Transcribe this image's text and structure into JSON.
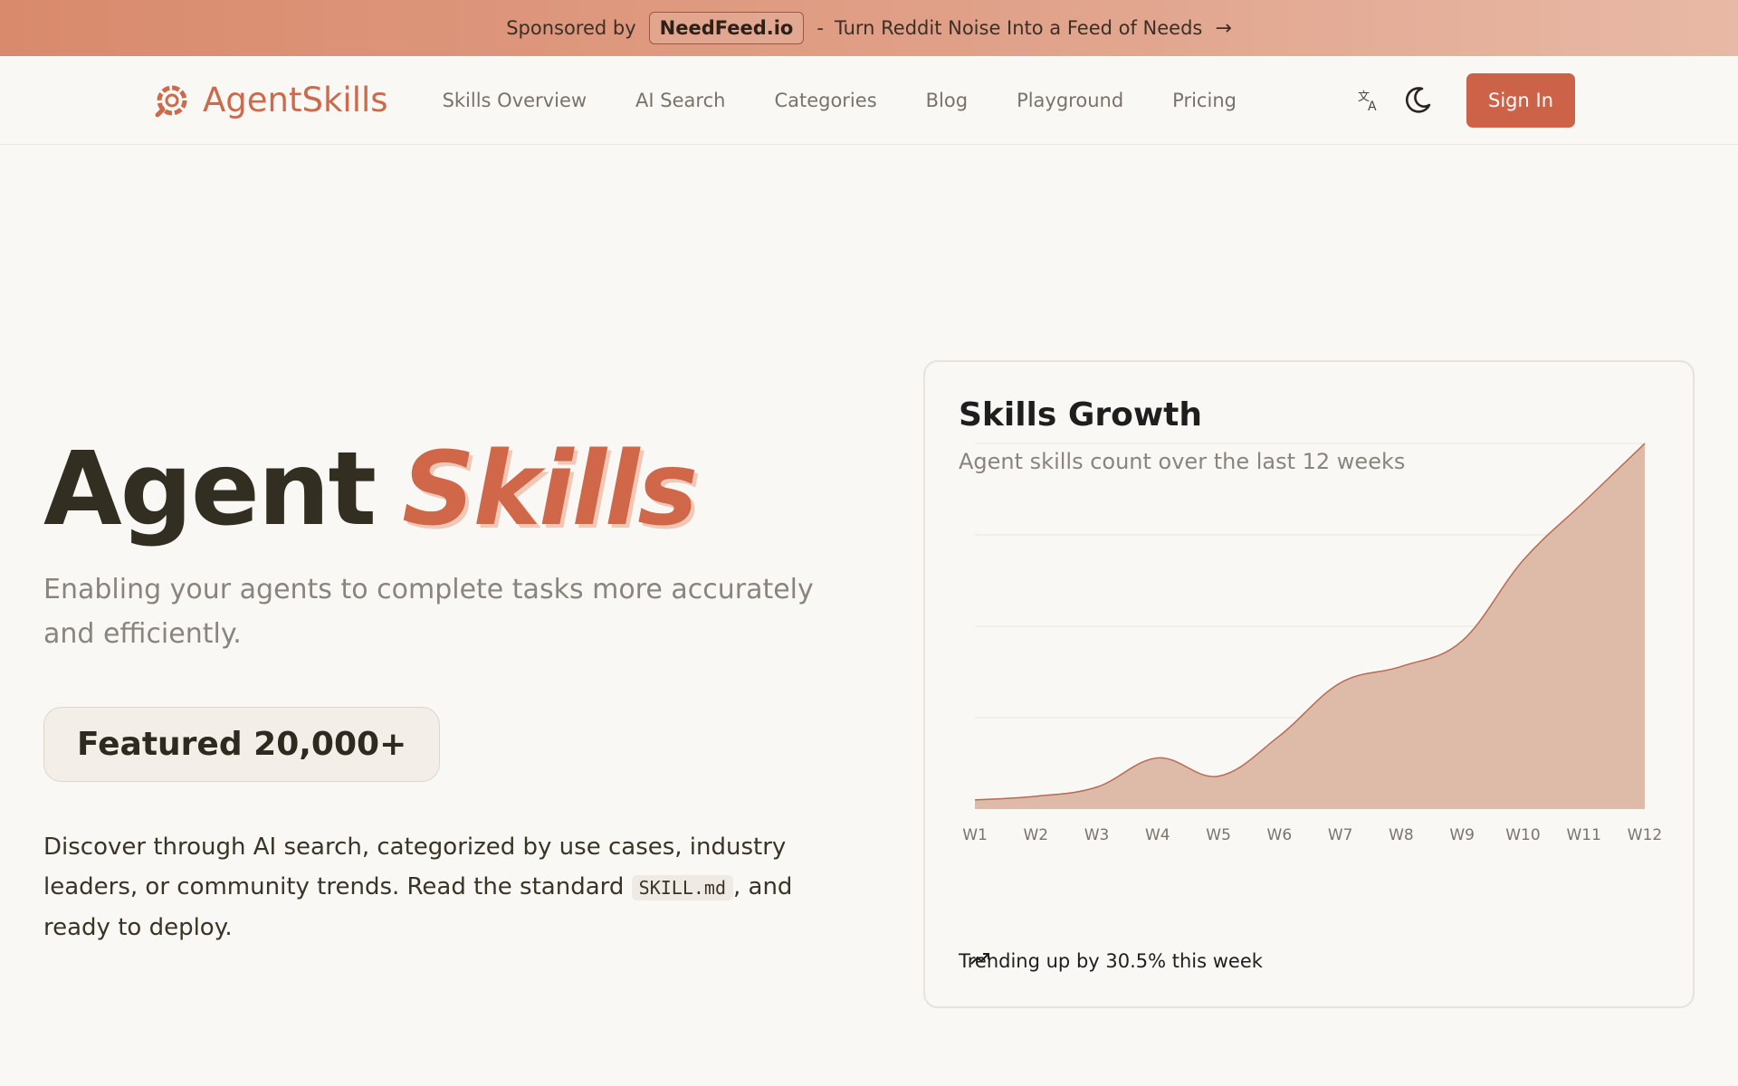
{
  "sponsor": {
    "prefix": "Sponsored by",
    "brand": "NeedFeed.io",
    "separator": "-",
    "tagline": "Turn Reddit Noise Into a Feed of Needs"
  },
  "nav": {
    "brand": "AgentSkills",
    "links": [
      "Skills Overview",
      "AI Search",
      "Categories",
      "Blog",
      "Playground",
      "Pricing"
    ],
    "signin": "Sign In"
  },
  "hero": {
    "title_word1": "Agent",
    "title_word2": "Skills",
    "subtitle": "Enabling your agents to complete tasks more accurately and efficiently.",
    "featured": "Featured 20,000+",
    "desc_before": "Discover through AI search, categorized by use cases, industry leaders, or community trends. Read the standard ",
    "desc_code": "SKILL.md",
    "desc_after": ", and ready to deploy."
  },
  "colors": {
    "accent": "#cc6247",
    "area_fill": "#dcb6a4",
    "area_stroke": "#b86a52"
  },
  "chart_data": {
    "type": "area",
    "title": "Skills Growth",
    "subtitle": "Agent skills count over the last 12 weeks",
    "categories": [
      "W1",
      "W2",
      "W3",
      "W4",
      "W5",
      "W6",
      "W7",
      "W8",
      "W9",
      "W10",
      "W11",
      "W12"
    ],
    "values": [
      2.5,
      3.5,
      6,
      14,
      9,
      20,
      34.5,
      39,
      46,
      68,
      84,
      100
    ],
    "ylim": [
      0,
      100
    ],
    "grid": true,
    "footer": "Trending up by 30.5% this week"
  }
}
